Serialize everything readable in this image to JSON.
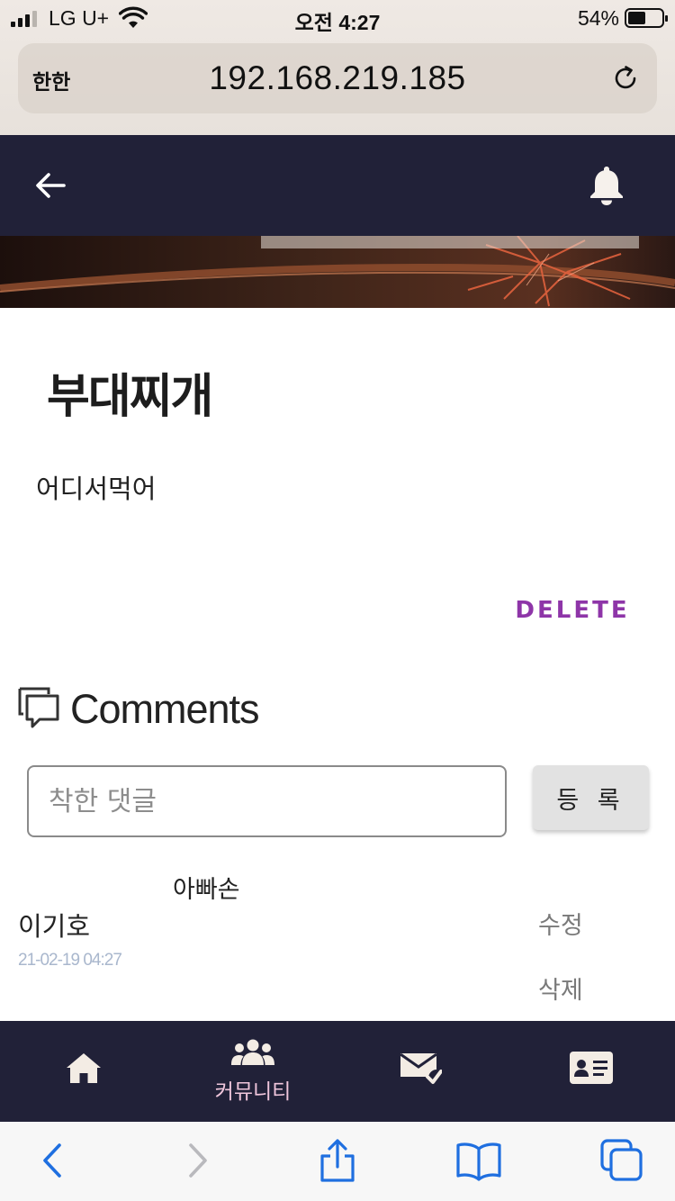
{
  "status_bar": {
    "carrier": "LG U+",
    "time": "오전 4:27",
    "battery_percent": "54%",
    "battery_level": 0.54,
    "signal_bars_filled": 3,
    "signal_bars_total": 4
  },
  "browser": {
    "reader_label": "한한",
    "url": "192.168.219.185"
  },
  "post": {
    "title": "부대찌개",
    "body": "어디서먹어",
    "delete_label": "DELETE"
  },
  "comments": {
    "heading": "Comments",
    "input_placeholder": "착한 댓글",
    "input_value": "",
    "submit_label": "등 록",
    "items": [
      {
        "text": "아빠손",
        "author": "이기호",
        "date": "21-02-19 04:27",
        "edit_label": "수정",
        "delete_label": "삭제"
      }
    ]
  },
  "bottom_nav": {
    "items": [
      {
        "icon": "home-icon",
        "label": ""
      },
      {
        "icon": "community-icon",
        "label": "커뮤니티"
      },
      {
        "icon": "mail-check-icon",
        "label": ""
      },
      {
        "icon": "profile-card-icon",
        "label": ""
      }
    ]
  },
  "colors": {
    "header_bg": "#212138",
    "delete_accent": "#8e35a8",
    "nav_active_label": "#f0c6dc",
    "nav_icon": "#f3ece4",
    "safari_accent": "#1f6fe0"
  }
}
